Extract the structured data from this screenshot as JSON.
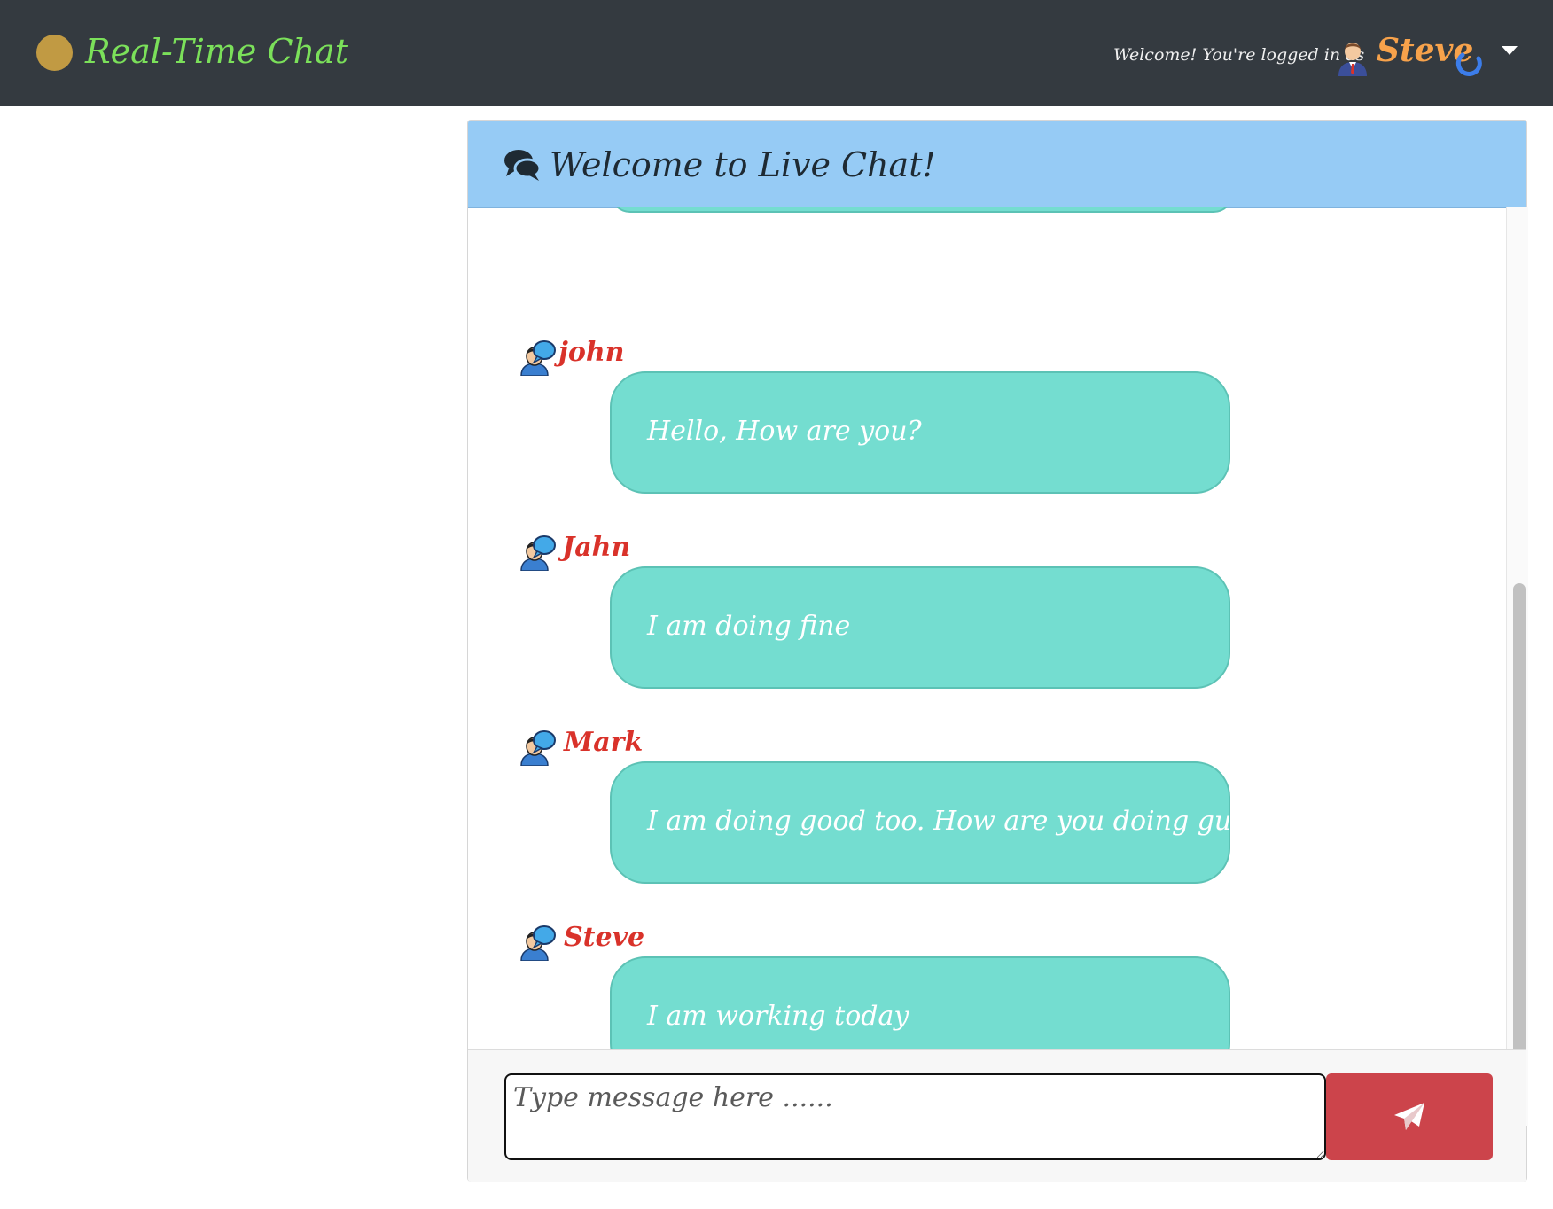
{
  "navbar": {
    "brand_title": "Real-Time Chat",
    "welcome_text": "Welcome! You're logged in as",
    "username": "Steve",
    "icons": {
      "brand": "circle-logo-icon",
      "avatar": "user-avatar-icon",
      "status": "loading-spinner-icon",
      "menu": "caret-down-icon"
    }
  },
  "chat": {
    "header_title": "Welcome to Live Chat!",
    "header_icon": "comments-icon",
    "messages": [
      {
        "author": "john",
        "text": "Hello, How are you?"
      },
      {
        "author": "Jahn",
        "text": "I am doing fine"
      },
      {
        "author": "Mark",
        "text": "I am doing good too. How are you doing guys?"
      },
      {
        "author": "Steve",
        "text": "I am working today"
      }
    ],
    "input_placeholder": "Type message here ......",
    "send_icon": "paper-plane-icon"
  },
  "colors": {
    "navbar_bg": "#343a40",
    "brand_text": "#7be05a",
    "brand_dot": "#c19a43",
    "username": "#f7a24b",
    "header_bg": "#96cbf5",
    "bubble_bg": "#74ddd0",
    "author": "#d9322a",
    "send_button": "#cc444b"
  }
}
